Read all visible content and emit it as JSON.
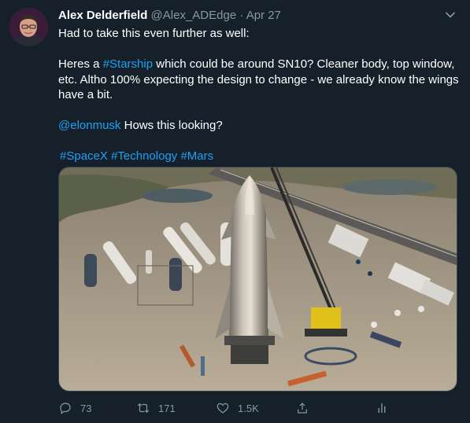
{
  "tweet": {
    "author_name": "Alex Delderfield",
    "handle": "@Alex_ADEdge",
    "separator": "·",
    "date": "Apr 27",
    "line1": "Had to take this even further as well:",
    "p2_before": "Heres a ",
    "p2_hashtag": "#Starship",
    "p2_after": " which could be around SN10? Cleaner body, top window, etc. Altho 100% expecting the design to change - we already know the wings have a bit.",
    "mention": "@elonmusk",
    "mention_after": " Hows this looking?",
    "hashtags": [
      "#SpaceX",
      "#Technology",
      "#Mars"
    ]
  },
  "actions": {
    "reply_count": "73",
    "retweet_count": "171",
    "like_count": "1.5K"
  },
  "colors": {
    "background": "#15202b",
    "link": "#1da1f2",
    "muted": "#8899a6"
  },
  "icons": [
    "chevron-down-icon",
    "reply-icon",
    "retweet-icon",
    "like-icon",
    "share-icon",
    "analytics-icon"
  ]
}
